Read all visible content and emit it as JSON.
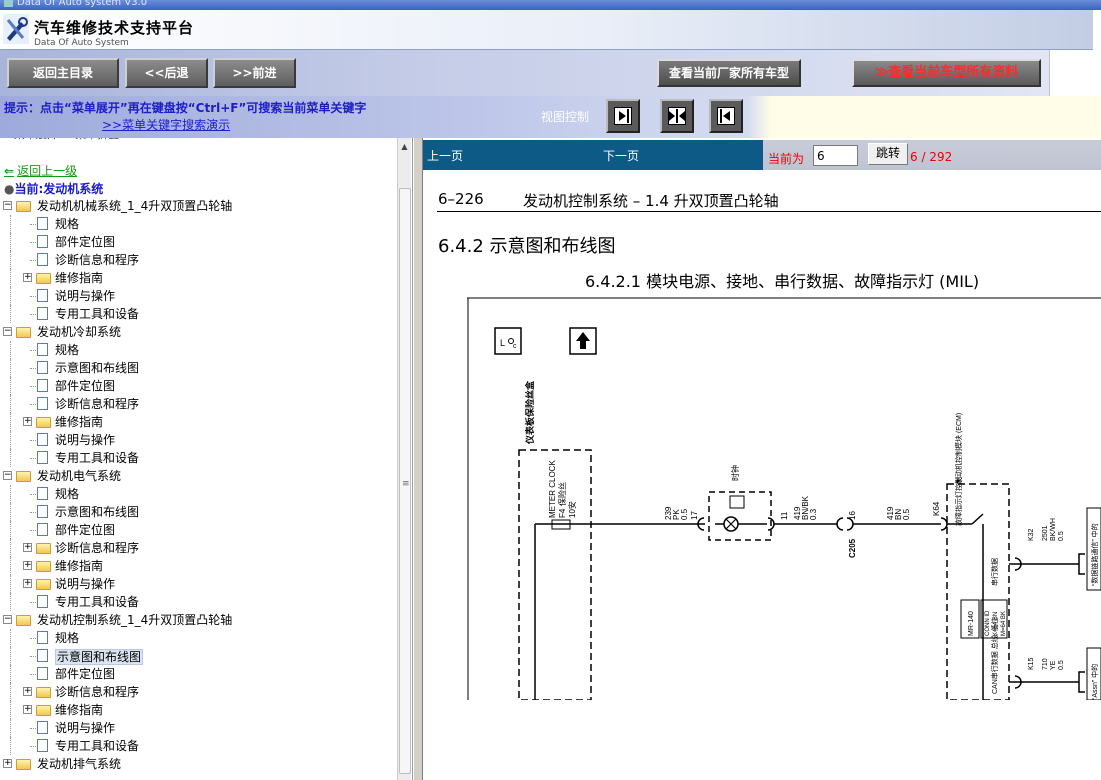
{
  "window": {
    "title": "Data Of Auto system V3.0"
  },
  "header": {
    "title": "汽车维修技术支持平台",
    "subtitle": "Data Of Auto System"
  },
  "toolbar": {
    "home": "返回主目录",
    "back": "<<后退",
    "forward": ">>前进",
    "all_vehicles": "查看当前厂家所有车型",
    "all_data": "≫查看当前车型所有资料"
  },
  "hint": {
    "text": "提示：点击“菜单展开”再在键盘按“Ctrl+F”可搜索当前菜单关键字",
    "demo_link": ">>菜单关键字搜索演示",
    "view_control": "视图控制"
  },
  "tree": {
    "back_up": "返回上一级",
    "current": "当前:发动机系统",
    "items": [
      {
        "level": 0,
        "type": "folder",
        "expand": "-",
        "label": "发动机机械系统_1_4升双顶置凸轮轴"
      },
      {
        "level": 1,
        "type": "doc",
        "label": "规格"
      },
      {
        "level": 1,
        "type": "doc",
        "label": "部件定位图"
      },
      {
        "level": 1,
        "type": "doc",
        "label": "诊断信息和程序"
      },
      {
        "level": 1,
        "type": "folder",
        "expand": "+",
        "label": "维修指南"
      },
      {
        "level": 1,
        "type": "doc",
        "label": "说明与操作"
      },
      {
        "level": 1,
        "type": "doc",
        "label": "专用工具和设备"
      },
      {
        "level": 0,
        "type": "folder",
        "expand": "-",
        "label": "发动机冷却系统"
      },
      {
        "level": 1,
        "type": "doc",
        "label": "规格"
      },
      {
        "level": 1,
        "type": "doc",
        "label": "示意图和布线图"
      },
      {
        "level": 1,
        "type": "doc",
        "label": "部件定位图"
      },
      {
        "level": 1,
        "type": "doc",
        "label": "诊断信息和程序"
      },
      {
        "level": 1,
        "type": "folder",
        "expand": "+",
        "label": "维修指南"
      },
      {
        "level": 1,
        "type": "doc",
        "label": "说明与操作"
      },
      {
        "level": 1,
        "type": "doc",
        "label": "专用工具和设备"
      },
      {
        "level": 0,
        "type": "folder",
        "expand": "-",
        "label": "发动机电气系统"
      },
      {
        "level": 1,
        "type": "doc",
        "label": "规格"
      },
      {
        "level": 1,
        "type": "doc",
        "label": "示意图和布线图"
      },
      {
        "level": 1,
        "type": "doc",
        "label": "部件定位图"
      },
      {
        "level": 1,
        "type": "folder",
        "expand": "+",
        "label": "诊断信息和程序"
      },
      {
        "level": 1,
        "type": "folder",
        "expand": "+",
        "label": "维修指南"
      },
      {
        "level": 1,
        "type": "folder",
        "expand": "+",
        "label": "说明与操作"
      },
      {
        "level": 1,
        "type": "doc",
        "label": "专用工具和设备"
      },
      {
        "level": 0,
        "type": "folder",
        "expand": "-",
        "label": "发动机控制系统_1_4升双顶置凸轮轴"
      },
      {
        "level": 1,
        "type": "doc",
        "label": "规格"
      },
      {
        "level": 1,
        "type": "doc",
        "label": "示意图和布线图",
        "selected": true
      },
      {
        "level": 1,
        "type": "doc",
        "label": "部件定位图"
      },
      {
        "level": 1,
        "type": "folder",
        "expand": "+",
        "label": "诊断信息和程序"
      },
      {
        "level": 1,
        "type": "folder",
        "expand": "+",
        "label": "维修指南"
      },
      {
        "level": 1,
        "type": "doc",
        "label": "说明与操作"
      },
      {
        "level": 1,
        "type": "doc",
        "label": "专用工具和设备"
      },
      {
        "level": 0,
        "type": "folder",
        "expand": "+",
        "label": "发动机排气系统"
      }
    ]
  },
  "nav": {
    "prev": "上一页",
    "next": "下一页",
    "current_label": "当前为",
    "page_value": "6",
    "jump": "跳转",
    "page_count": "6 / 292"
  },
  "document": {
    "page_number": "6–226",
    "page_title": "发动机控制系统 – 1.4 升双顶置凸轮轴",
    "section_title": "6.4.2 示意图和布线图",
    "subsection_title": "6.4.2.1 模块电源、接地、串行数据、故障指示灯 (MIL)"
  },
  "diagram": {
    "fuse_panel": "仪表板保险丝盒",
    "fuse_name": "METER CLOCK",
    "fuse_id": "F4",
    "fuse_desc": "保险丝",
    "fuse_rating": "10安",
    "lamp_label": "时钟",
    "wire1_circuit": "239",
    "wire1_color": "PK",
    "wire1_size": "0.5",
    "wire1_pin": "17",
    "wire2_pin": "11",
    "wire2_circuit": "419",
    "wire2_color": "BN/BK",
    "wire2_size": "0.3",
    "connector_c205": "C205",
    "connector_pin": "16",
    "wire3_circuit": "419",
    "wire3_color": "BN",
    "wire3_size": "0.5",
    "pin_k64": "K64",
    "ecm_label": "发动机控制模块 (ECM)",
    "mil_label": "故障指示灯控制",
    "serial_label": "串行数据",
    "pin_k32": "K32",
    "wire4_circuit": "2501",
    "wire4_color": "BK/WH",
    "wire4_size": "0.5",
    "conn_id_title": "CONN ID",
    "conn_id_1": "K=64 BN",
    "conn_id_2": "M=64 BK",
    "conn_mr": "MR-140",
    "can_label": "CAN串行数据 总线, 低位",
    "pin_k15": "K15",
    "wire5_circuit": "710",
    "wire5_color": "YE",
    "wire5_size": "0.5",
    "right1": "“数据链路通信” 中的",
    "right2": "“Assn” 中的"
  }
}
